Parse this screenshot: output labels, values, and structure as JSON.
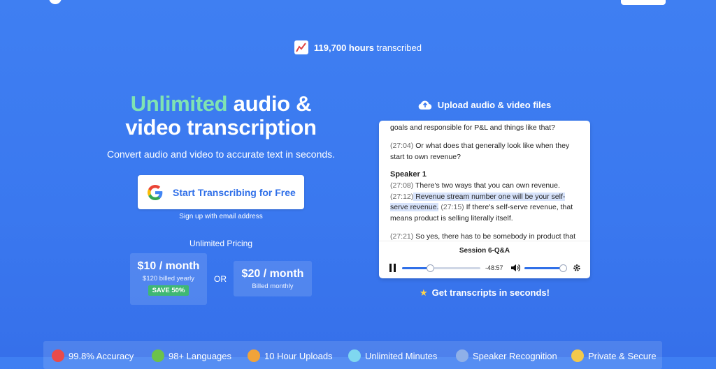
{
  "stats": {
    "hours": "119,700 hours",
    "suffix": "transcribed"
  },
  "hero": {
    "title_accent": "Unlimited",
    "title_rest_1": "audio &",
    "title_line_2": "video transcription",
    "subtitle": "Convert audio and video to accurate text in seconds."
  },
  "cta": {
    "label": "Start Transcribing for Free",
    "signup_link": "Sign up with email address"
  },
  "pricing": {
    "title": "Unlimited Pricing",
    "or": "OR",
    "yearly": {
      "price": "$10 / month",
      "note": "$120 billed yearly",
      "badge": "SAVE 50%"
    },
    "monthly": {
      "price": "$20 / month",
      "note": "Billed monthly"
    }
  },
  "demo": {
    "upload_label": "Upload audio & video files",
    "transcript": {
      "line_top": "goals and responsible for P&L and things like that?",
      "p1_time": "(27:04)",
      "p1_text": " Or what does that generally look like when they start to own revenue?",
      "speaker": "Speaker 1",
      "p2_time_a": "(27:08)",
      "p2_text_a": " There's two ways that you can own revenue.",
      "p2_time_b": "(27:12)",
      "p2_hl": " Revenue stream number one will be your self-serve revenue.",
      "p2_time_c": " (27:15)",
      "p2_text_c": " If there's self-serve revenue, that means product is selling literally itself.",
      "p3_time": "(27:21)",
      "p3_text": " So yes, there has to be somebody in product that"
    },
    "player": {
      "session_title": "Session 6-Q&A",
      "time_remaining": "-48:57",
      "progress": 0.36,
      "volume": 0.95
    },
    "tagline": "Get transcripts in seconds!"
  },
  "features": [
    {
      "label": "99.8% Accuracy",
      "icon": "target-icon",
      "color": "#e94b4b"
    },
    {
      "label": "98+ Languages",
      "icon": "globe-icon",
      "color": "#6cc24a"
    },
    {
      "label": "10 Hour Uploads",
      "icon": "upload-icon",
      "color": "#f0a33a"
    },
    {
      "label": "Unlimited Minutes",
      "icon": "infinity-icon",
      "color": "#7fd7f0"
    },
    {
      "label": "Speaker Recognition",
      "icon": "speaker-icon",
      "color": "#8fb0e8"
    },
    {
      "label": "Private & Secure",
      "icon": "lock-icon",
      "color": "#f2c94c"
    }
  ],
  "colors": {
    "accent_green": "#7fe3b2",
    "brand_blue": "#2f6fe8",
    "badge_green": "#3fb873"
  }
}
